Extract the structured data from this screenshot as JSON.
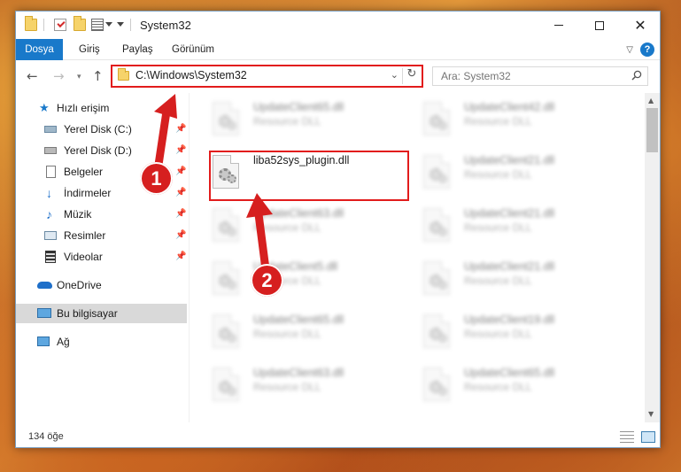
{
  "window": {
    "title": "System32",
    "controls": {
      "minimize": "—",
      "maximize": "☐",
      "close": "✕"
    }
  },
  "ribbon": {
    "tabs": [
      "Dosya",
      "Giriş",
      "Paylaş",
      "Görünüm"
    ],
    "help": "?"
  },
  "navigation": {
    "address": "C:\\Windows\\System32",
    "search_placeholder": "Ara: System32"
  },
  "sidebar": {
    "items": [
      {
        "label": "Hızlı erişim",
        "icon": "star-icon",
        "pinned": false
      },
      {
        "label": "Yerel Disk (C:)",
        "icon": "drive-icon",
        "pinned": true
      },
      {
        "label": "Yerel Disk (D:)",
        "icon": "drive-icon",
        "pinned": true
      },
      {
        "label": "Belgeler",
        "icon": "documents-icon",
        "pinned": true
      },
      {
        "label": "İndirmeler",
        "icon": "download-icon",
        "pinned": true
      },
      {
        "label": "Müzik",
        "icon": "music-icon",
        "pinned": true
      },
      {
        "label": "Resimler",
        "icon": "pictures-icon",
        "pinned": true
      },
      {
        "label": "Videolar",
        "icon": "videos-icon",
        "pinned": true
      },
      {
        "label": "OneDrive",
        "icon": "onedrive-icon",
        "pinned": false
      },
      {
        "label": "Bu bilgisayar",
        "icon": "computer-icon",
        "pinned": false,
        "selected": true
      },
      {
        "label": "Ağ",
        "icon": "network-icon",
        "pinned": false
      }
    ]
  },
  "files": {
    "left_column": [
      {
        "name": "UpdateClient65.dll",
        "type": "Resource DLL"
      },
      {
        "name": "liba52sys_plugin.dll",
        "type": ""
      },
      {
        "name": "UpdateClient63.dll",
        "type": "Resource DLL"
      },
      {
        "name": "UpdateClient5.dll",
        "type": "Resource DLL"
      },
      {
        "name": "UpdateClient65.dll",
        "type": "Resource DLL"
      },
      {
        "name": "UpdateClient63.dll",
        "type": "Resource DLL"
      }
    ],
    "right_column": [
      {
        "name": "UpdateClient42.dll",
        "type": "Resource DLL"
      },
      {
        "name": "UpdateClient21.dll",
        "type": "Resource DLL"
      },
      {
        "name": "UpdateClient21.dll",
        "type": "Resource DLL"
      },
      {
        "name": "UpdateClient21.dll",
        "type": "Resource DLL"
      },
      {
        "name": "UpdateClient19.dll",
        "type": "Resource DLL"
      },
      {
        "name": "UpdateClient65.dll",
        "type": "Resource DLL"
      }
    ]
  },
  "status": {
    "item_count": "134 öğe"
  },
  "annotations": {
    "step1": "1",
    "step2": "2",
    "color": "#d61f1f"
  }
}
